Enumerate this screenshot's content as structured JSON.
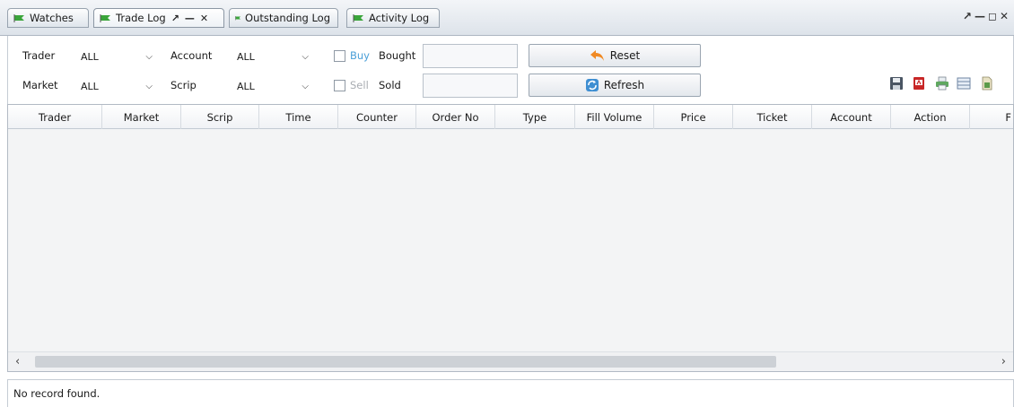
{
  "tabs": [
    {
      "label": "Watches",
      "active": false
    },
    {
      "label": "Trade Log",
      "active": true
    },
    {
      "label": "Outstanding Log",
      "active": false
    },
    {
      "label": "Activity Log",
      "active": false
    }
  ],
  "tab_controls": {
    "pin": "↗",
    "minimize": "—",
    "close": "✕"
  },
  "window_controls": {
    "pin": "↗",
    "minimize": "—",
    "maximize": "◻",
    "close": "✕"
  },
  "filters": {
    "trader": {
      "label": "Trader",
      "value": "ALL"
    },
    "market": {
      "label": "Market",
      "value": "ALL"
    },
    "account": {
      "label": "Account",
      "value": "ALL"
    },
    "scrip": {
      "label": "Scrip",
      "value": "ALL"
    },
    "buy": {
      "label": "Buy",
      "checked": false
    },
    "sell": {
      "label": "Sell",
      "checked": false
    },
    "bought": {
      "label": "Bought",
      "value": ""
    },
    "sold": {
      "label": "Sold",
      "value": ""
    }
  },
  "buttons": {
    "reset": "Reset",
    "refresh": "Refresh"
  },
  "toolbar_icons": [
    "save-icon",
    "pdf-icon",
    "print-icon",
    "columns-icon",
    "export-icon"
  ],
  "grid": {
    "columns": [
      "Trader",
      "Market",
      "Scrip",
      "Time",
      "Counter",
      "Order No",
      "Type",
      "Fill Volume",
      "Price",
      "Ticket",
      "Account",
      "Action",
      "F"
    ],
    "rows": []
  },
  "status": "No record found.",
  "colors": {
    "buy_label": "#4a9fd8",
    "sell_label": "#a9adb2",
    "flag_green": "#3aa53a",
    "reset_arrow": "#f08a24",
    "refresh_icon": "#3f8fd2"
  }
}
